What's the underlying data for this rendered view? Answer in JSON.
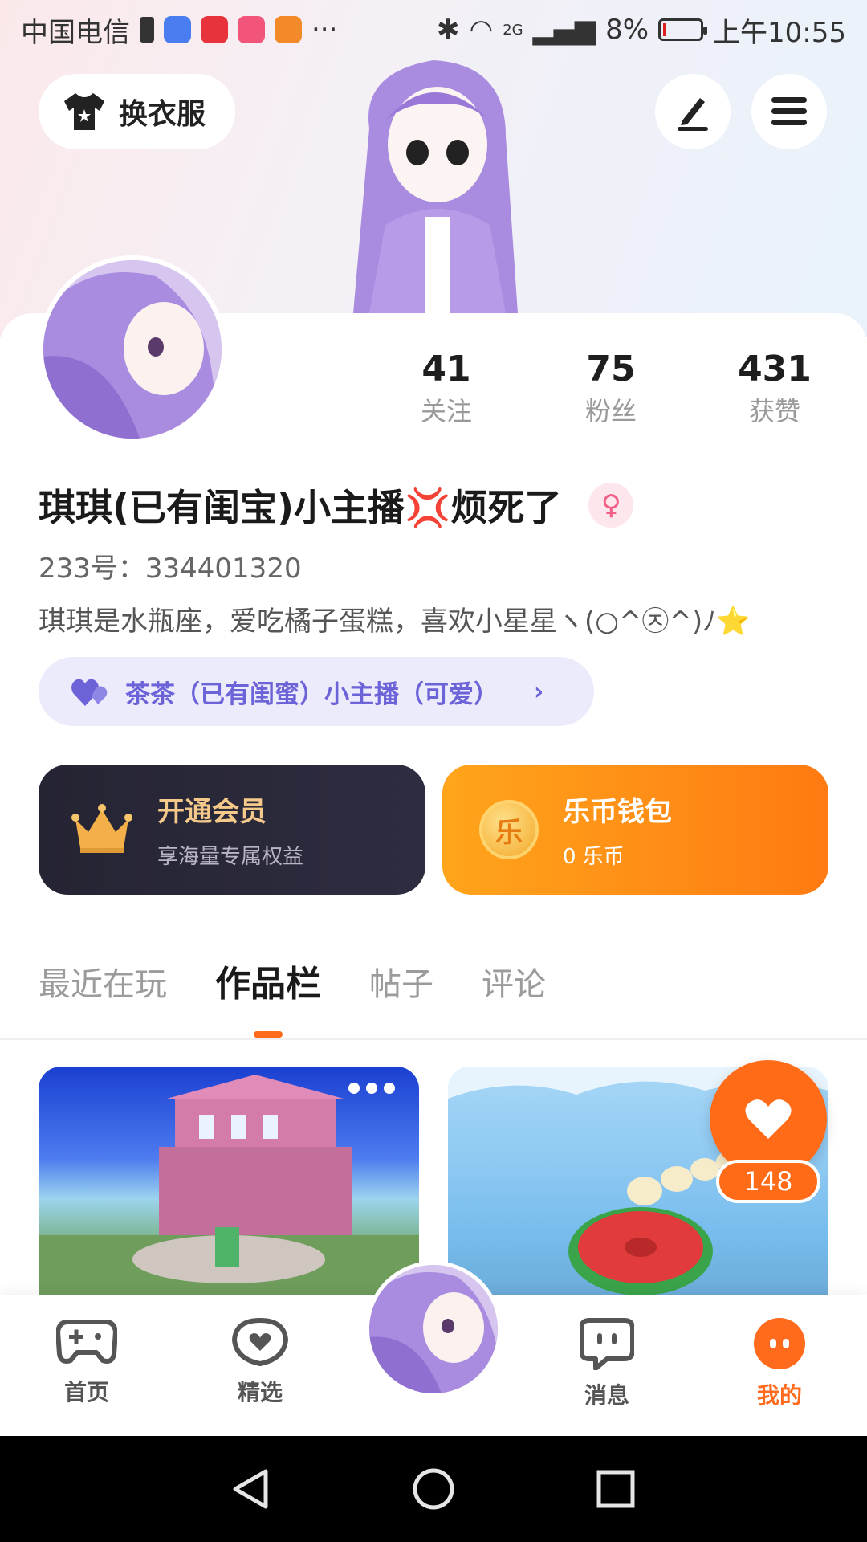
{
  "status_bar": {
    "carrier": "中国电信",
    "network": "2G",
    "battery": "8%",
    "time": "上午10:55",
    "overflow": "···"
  },
  "header": {
    "outfit_button": "换衣服",
    "edit_icon": "pen-icon",
    "menu_icon": "hamburger-icon"
  },
  "profile": {
    "stats": [
      {
        "value": "41",
        "label": "关注"
      },
      {
        "value": "75",
        "label": "粉丝"
      },
      {
        "value": "431",
        "label": "获赞"
      }
    ],
    "nickname": "琪琪(已有闺宝)小主播💢烦死了",
    "gender_symbol": "♀",
    "uid": "233号：334401320",
    "bio": "琪琪是水瓶座，爱吃橘子蛋糕，喜欢小星星ヽ(○^㉨^)ﾉ⭐",
    "bestie": "茶茶（已有闺蜜）小主播（可爱）"
  },
  "cards": {
    "vip": {
      "title": "开通会员",
      "subtitle": "享海量专属权益",
      "color": "#f5c98a"
    },
    "wallet": {
      "title": "乐币钱包",
      "subtitle": "0 乐币",
      "coin_glyph": "乐"
    }
  },
  "tabs": [
    "最近在玩",
    "作品栏",
    "帖子",
    "评论"
  ],
  "active_tab": "作品栏",
  "like_count": "148",
  "bottom_nav": [
    {
      "label": "首页",
      "icon": "gamepad-icon"
    },
    {
      "label": "精选",
      "icon": "heart-chat-icon"
    },
    {
      "label": "消息",
      "icon": "message-icon"
    },
    {
      "label": "我的",
      "icon": "me-icon"
    }
  ],
  "colors": {
    "accent": "#ff6a1c",
    "bestie": "#6d63d8"
  }
}
